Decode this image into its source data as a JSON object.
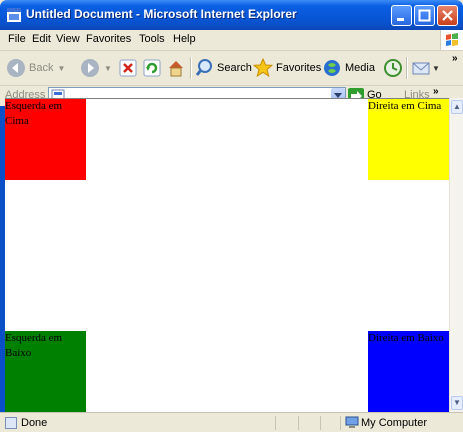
{
  "window": {
    "title": "Untitled Document - Microsoft Internet Explorer"
  },
  "menu": {
    "items": [
      "File",
      "Edit",
      "View",
      "Favorites",
      "Tools",
      "Help"
    ]
  },
  "toolbar": {
    "back_label": "Back",
    "search_label": "Search",
    "favorites_label": "Favorites",
    "media_label": "Media"
  },
  "address": {
    "label": "Address",
    "value": "",
    "go_label": "Go",
    "links_label": "Links"
  },
  "page": {
    "boxes": {
      "top_left": "Esquerda em Cima",
      "top_right": "Direita em Cima",
      "bottom_left": "Esquerda em Baixo",
      "bottom_right": "Direita em Baixo"
    },
    "colors": {
      "top_left": "#ff0000",
      "top_right": "#ffff00",
      "bottom_left": "#008000",
      "bottom_right": "#0000ff"
    }
  },
  "status": {
    "text": "Done",
    "zone": "My Computer"
  }
}
